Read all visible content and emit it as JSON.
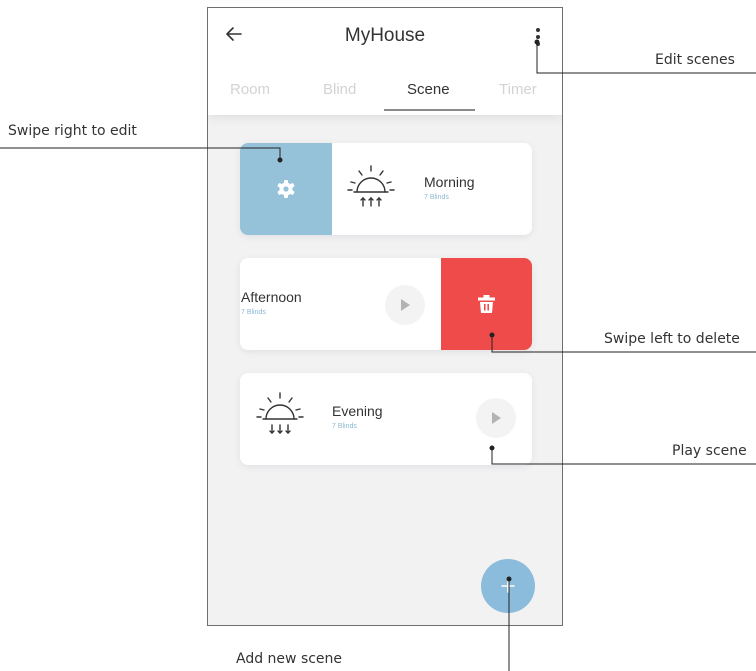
{
  "app": {
    "title": "MyHouse",
    "tabs": [
      {
        "label": "Room",
        "active": false
      },
      {
        "label": "Blind",
        "active": false
      },
      {
        "label": "Scene",
        "active": true
      },
      {
        "label": "Timer",
        "active": false
      }
    ]
  },
  "scenes": [
    {
      "name": "Morning",
      "count": "7 Blinds",
      "state": "swiped-right",
      "icon": "sunrise-icon"
    },
    {
      "name": "Afternoon",
      "count": "7 Blinds",
      "state": "swiped-left",
      "icon": "none"
    },
    {
      "name": "Evening",
      "count": "7 Blinds",
      "state": "normal",
      "icon": "sunset-icon"
    }
  ],
  "callouts": {
    "edit_scenes": "Edit scenes",
    "swipe_right": "Swipe right to edit",
    "swipe_left": "Swipe left to delete",
    "play_scene": "Play scene",
    "add_scene": "Add new scene"
  },
  "colors": {
    "edit_blue": "#95c1d9",
    "delete_red": "#ef4b4b",
    "fab_blue": "#8bbcdb",
    "screen_bg": "#f2f2f3"
  },
  "icons": {
    "back": "back-arrow-icon",
    "menu": "more-vertical-icon",
    "edit": "gear-icon",
    "delete": "trash-icon",
    "play": "play-icon",
    "add": "plus-icon"
  }
}
